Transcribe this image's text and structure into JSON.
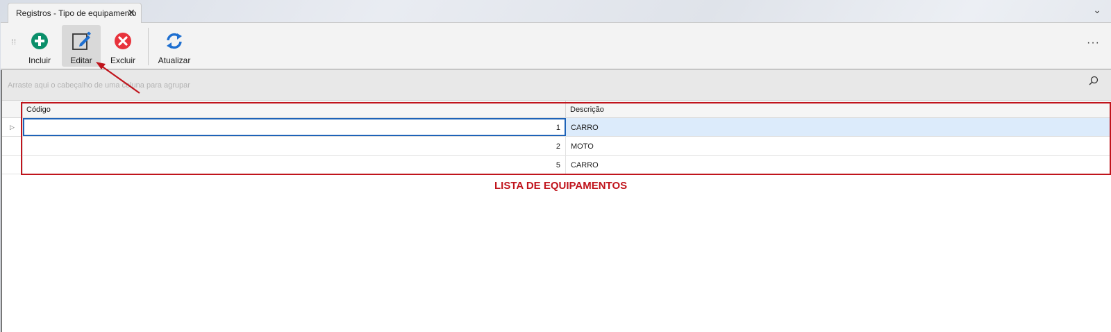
{
  "tab": {
    "title": "Registros - Tipo de equipamento",
    "close_glyph": "✕"
  },
  "tab_overflow_glyph": "⌄",
  "toolbar": {
    "incluir": {
      "label": "Incluir",
      "icon": "add-circle-icon",
      "color": "#0a8f6a"
    },
    "editar": {
      "label": "Editar",
      "icon": "edit-icon",
      "color": "#1e6fd0"
    },
    "excluir": {
      "label": "Excluir",
      "icon": "delete-circle-icon",
      "color": "#e8333c"
    },
    "atualizar": {
      "label": "Atualizar",
      "icon": "refresh-icon",
      "color": "#1e6fd0"
    },
    "more_glyph": "···"
  },
  "group_bar": {
    "hint": "Arraste aqui o cabeçalho de uma coluna para agrupar"
  },
  "grid": {
    "columns": [
      "Código",
      "Descrição"
    ],
    "rows": [
      {
        "codigo": "1",
        "descricao": "CARRO"
      },
      {
        "codigo": "2",
        "descricao": "MOTO"
      },
      {
        "codigo": "5",
        "descricao": "CARRO"
      }
    ],
    "row_indicator_glyph": "▷"
  },
  "annotation": {
    "text": "LISTA DE EQUIPAMENTOS",
    "color": "#c0141c"
  }
}
